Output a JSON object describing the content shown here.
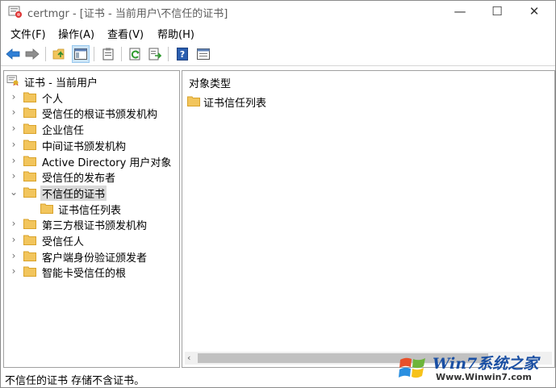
{
  "window": {
    "title": "certmgr - [证书 - 当前用户\\不信任的证书]",
    "minimize_glyph": "—",
    "maximize_glyph": "☐",
    "close_glyph": "✕"
  },
  "menu": [
    {
      "label": "文件(F)"
    },
    {
      "label": "操作(A)"
    },
    {
      "label": "查看(V)"
    },
    {
      "label": "帮助(H)"
    }
  ],
  "toolbar": {
    "icons": [
      "back-arrow-icon",
      "forward-arrow-icon",
      "up-folder-icon",
      "show-hide-tree-icon",
      "clipboard-icon",
      "refresh-icon",
      "export-list-icon",
      "help-icon",
      "properties-icon"
    ]
  },
  "tree": {
    "root": "证书 - 当前用户",
    "items": [
      {
        "label": "个人"
      },
      {
        "label": "受信任的根证书颁发机构"
      },
      {
        "label": "企业信任"
      },
      {
        "label": "中间证书颁发机构"
      },
      {
        "label": "Active Directory 用户对象"
      },
      {
        "label": "受信任的发布者"
      },
      {
        "label": "不信任的证书",
        "expanded": true,
        "selected": true,
        "children": [
          {
            "label": "证书信任列表"
          }
        ]
      },
      {
        "label": "第三方根证书颁发机构"
      },
      {
        "label": "受信任人"
      },
      {
        "label": "客户端身份验证颁发者"
      },
      {
        "label": "智能卡受信任的根"
      }
    ]
  },
  "content": {
    "column_header": "对象类型",
    "items": [
      {
        "label": "证书信任列表"
      }
    ]
  },
  "status": {
    "text": "不信任的证书 存储不含证书。"
  },
  "watermark": {
    "title": "Win7系统之家",
    "url": "Www.Winwin7.com"
  },
  "colors": {
    "folder": "#f2c55c",
    "folder_dark": "#d9a32b",
    "selection": "#d9d9d9",
    "toolbar_active": "#cce4f7"
  }
}
